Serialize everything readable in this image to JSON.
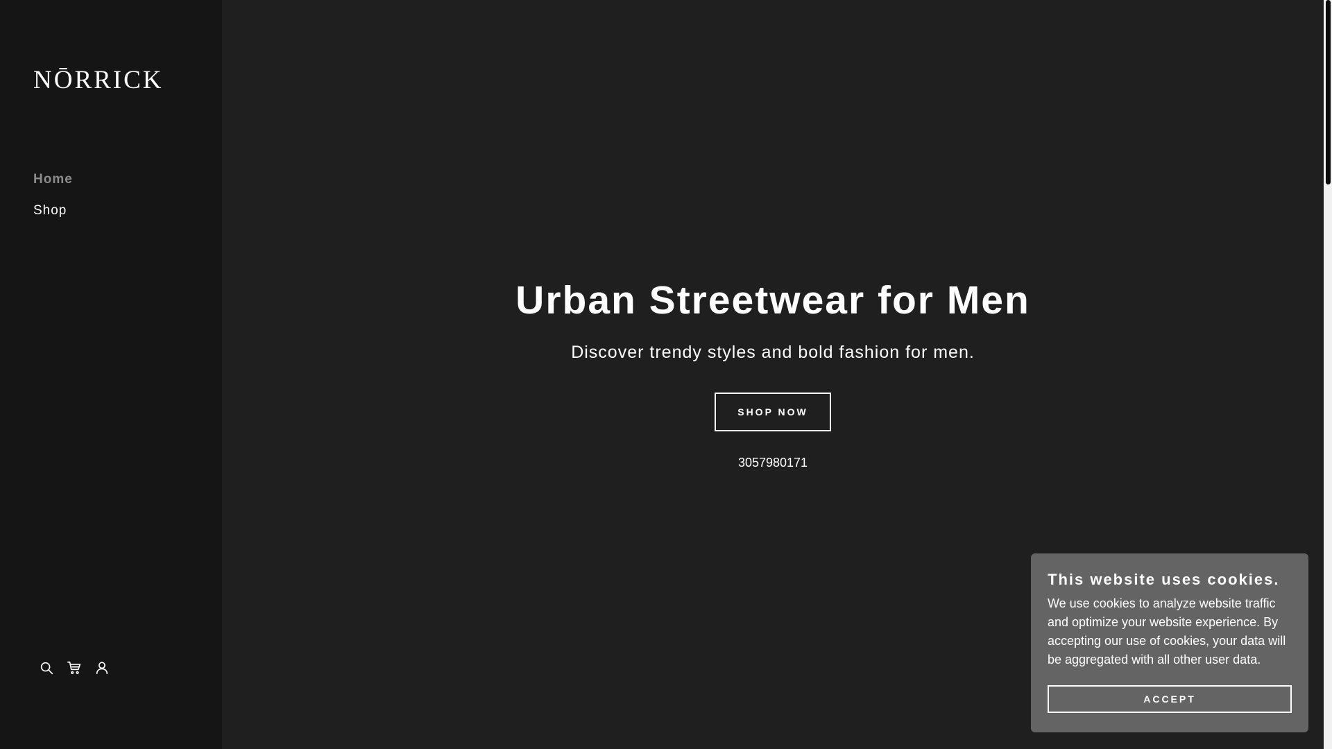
{
  "brand": {
    "logo": "NŌRRICK"
  },
  "sidebar": {
    "nav": [
      {
        "label": "Home",
        "active": true
      },
      {
        "label": "Shop",
        "active": false
      }
    ],
    "icons": [
      "search-icon",
      "cart-icon",
      "account-icon"
    ]
  },
  "hero": {
    "title": "Urban Streetwear for Men",
    "subtitle": "Discover trendy styles and bold fashion for men.",
    "cta_label": "SHOP NOW",
    "phone": "3057980171"
  },
  "cookie": {
    "title": "This website uses cookies.",
    "text": "We use cookies to analyze website traffic and optimize your website experience. By accepting our use of cookies, your data will be aggregated with all other user data.",
    "accept_label": "ACCEPT"
  },
  "colors": {
    "page_background": "#1f1f1f",
    "sidebar_background": "#151515",
    "cookie_background": "#646464",
    "text": "#ffffff",
    "nav_active": "#8c8c8c"
  }
}
